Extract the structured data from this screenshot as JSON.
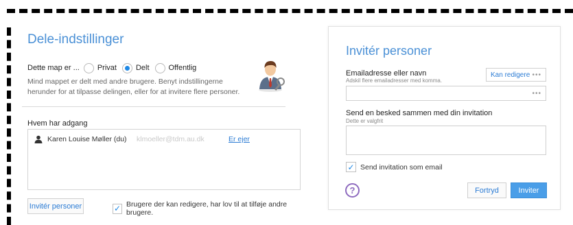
{
  "share_settings": {
    "title": "Dele-indstillinger",
    "folder_is_label": "Dette map er ...",
    "options": [
      {
        "label": "Privat",
        "selected": false
      },
      {
        "label": "Delt",
        "selected": true
      },
      {
        "label": "Offentlig",
        "selected": false
      }
    ],
    "description_line1": "Mind mappet er delt med andre brugere. Benyt indstillingerne",
    "description_line2": "herunder for at tilpasse delingen, eller for at invitere flere personer.",
    "avatar_icon": "user-avatar-icon",
    "access_title": "Hvem har adgang",
    "access_list": [
      {
        "name": "Karen Louise Møller (du)",
        "email": "klmoeller@tdm.au.dk",
        "role": "Er ejer"
      }
    ],
    "invite_button": "Invitér personer",
    "allow_editors_label": "Brugere der kan redigere, har lov til at tilføje andre brugere.",
    "allow_editors_checked": true
  },
  "invite_panel": {
    "title": "Invitér personer",
    "email_label": "Emailadresse eller navn",
    "email_hint": "Adskil flere emailadresser med komma.",
    "permission_label": "Kan redigere",
    "more_dots": "•••",
    "email_value": "",
    "message_label": "Send en besked sammen med din invitation",
    "message_hint": "Dette er valgfrit",
    "message_value": "",
    "send_as_email_label": "Send invitation som email",
    "send_as_email_checked": true,
    "help_icon": "?",
    "cancel_button": "Fortryd",
    "send_button": "Inviter"
  },
  "colors": {
    "accent": "#4a90d6",
    "link": "#2a7bd4",
    "primary_button": "#4a9ee8",
    "help": "#8e6bbf"
  }
}
